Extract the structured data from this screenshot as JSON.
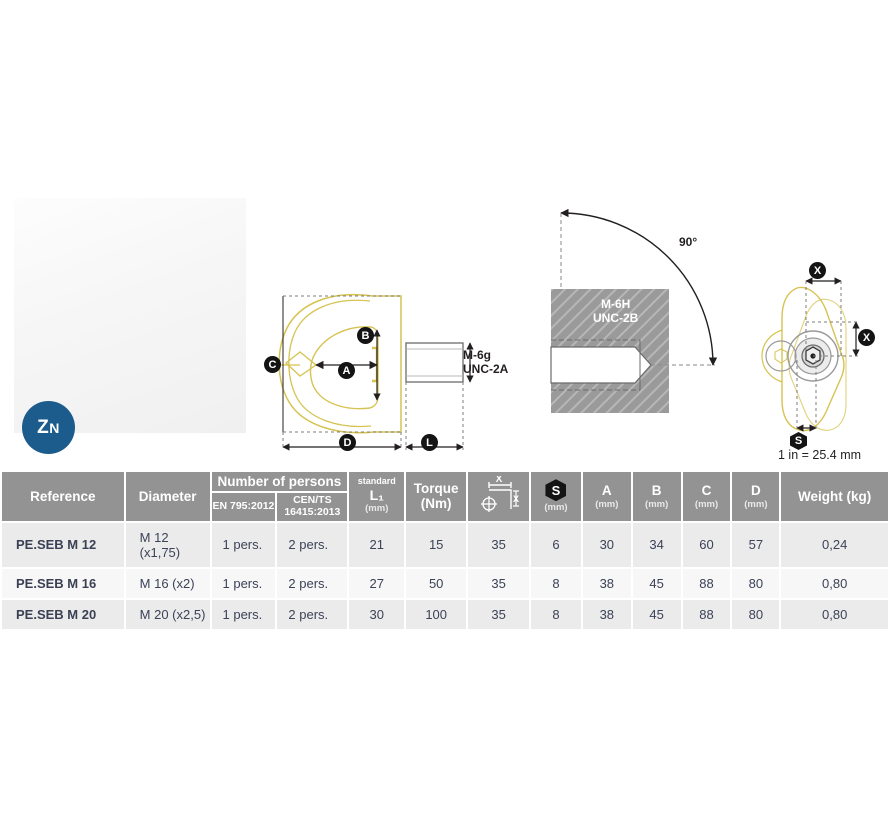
{
  "badge": {
    "symbol_main": "Z",
    "symbol_sub": "N",
    "color": "#1b5c8c"
  },
  "drawings": {
    "side_view": {
      "name": "eye-bolt-side-view",
      "outline_color": "#d6c351",
      "labels": {
        "c": "C",
        "b": "B",
        "a": "A",
        "d": "D",
        "l1": "L",
        "thread": "M-6g\nUNC-2A"
      }
    },
    "section_view": {
      "name": "threaded-hole-section-view",
      "angle": "90°",
      "thread": "M-6H\nUNC-2B",
      "block_color": "#9a9a9a"
    },
    "top_view": {
      "name": "eye-bolt-top-view",
      "labels": {
        "x_horizontal": "X",
        "x_vertical": "X",
        "s": "S"
      },
      "conversion_note": "1 in = 25.4 mm"
    }
  },
  "table": {
    "headers": {
      "reference": "Reference",
      "diameter": "Diameter",
      "number_of_persons": "Number of persons",
      "en": "EN\n795:2012",
      "cents": "CEN/TS\n16415:2013",
      "standard": "standard",
      "l1": "L₁",
      "l1_unit": "(mm)",
      "torque": "Torque\n(Nm)",
      "x_icon": "x-dimension-icon",
      "s_symbol": "S",
      "s_unit": "(mm)",
      "a": "A",
      "a_unit": "(mm)",
      "b": "B",
      "b_unit": "(mm)",
      "c": "C",
      "c_unit": "(mm)",
      "d": "D",
      "d_unit": "(mm)",
      "weight": "Weight\n(kg)"
    },
    "rows": [
      {
        "reference": "PE.SEB M 12",
        "diameter": "M 12 (x1,75)",
        "en": "1 pers.",
        "cents": "2 pers.",
        "l1": "21",
        "torque": "15",
        "x": "35",
        "s": "6",
        "a": "30",
        "b": "34",
        "c": "60",
        "d": "57",
        "weight": "0,24"
      },
      {
        "reference": "PE.SEB M 16",
        "diameter": "M 16 (x2)",
        "en": "1 pers.",
        "cents": "2 pers.",
        "l1": "27",
        "torque": "50",
        "x": "35",
        "s": "8",
        "a": "38",
        "b": "45",
        "c": "88",
        "d": "80",
        "weight": "0,80"
      },
      {
        "reference": "PE.SEB M 20",
        "diameter": "M 20 (x2,5)",
        "en": "1 pers.",
        "cents": "2 pers.",
        "l1": "30",
        "torque": "100",
        "x": "35",
        "s": "8",
        "a": "38",
        "b": "45",
        "c": "88",
        "d": "80",
        "weight": "0,80"
      }
    ]
  }
}
